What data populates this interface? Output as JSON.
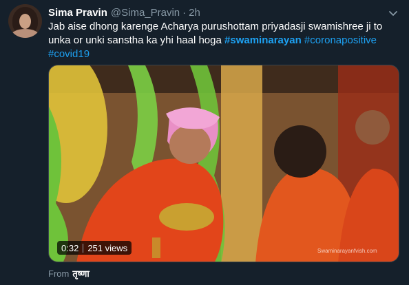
{
  "tweet": {
    "author_name": "Sima Pravin",
    "author_handle": "@Sima_Pravin",
    "separator": "·",
    "time": "2h",
    "text_plain": "Jab aise dhong karenge Acharya purushottam priyadasji swamishree ji to unka or unki sanstha ka yhi haal hoga",
    "hashtags": [
      "#swaminarayan",
      "#coronapositive",
      "#covid19"
    ],
    "chevron_icon": "chevron-down-icon"
  },
  "media": {
    "duration": "0:32",
    "views": "251 views",
    "watermark": "Swaminarayanfvish.com"
  },
  "footer": {
    "from_label": "From",
    "source_name": "तृष्णा"
  },
  "colors": {
    "background": "#15202b",
    "link": "#1da1f2",
    "muted": "#8899a6"
  }
}
